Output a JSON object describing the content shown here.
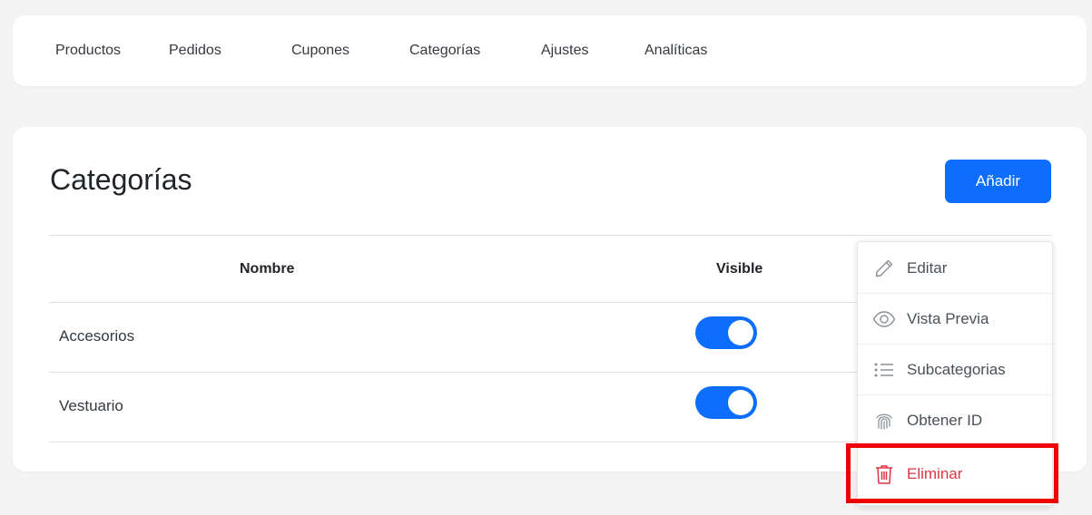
{
  "nav": {
    "items": [
      {
        "label": "Productos"
      },
      {
        "label": "Pedidos"
      },
      {
        "label": "Cupones"
      },
      {
        "label": "Categorías"
      },
      {
        "label": "Ajustes"
      },
      {
        "label": "Analíticas"
      }
    ]
  },
  "page": {
    "title": "Categorías",
    "add_label": "Añadir"
  },
  "table": {
    "headers": {
      "name": "Nombre",
      "visible": "Visible"
    },
    "rows": [
      {
        "name": "Accesorios",
        "visible": true
      },
      {
        "name": "Vestuario",
        "visible": true
      }
    ]
  },
  "context_menu": {
    "items": [
      {
        "label": "Editar",
        "icon": "pencil-icon"
      },
      {
        "label": "Vista Previa",
        "icon": "eye-icon"
      },
      {
        "label": "Subcategorias",
        "icon": "list-icon"
      },
      {
        "label": "Obtener ID",
        "icon": "fingerprint-icon"
      },
      {
        "label": "Eliminar",
        "icon": "trash-icon"
      }
    ]
  },
  "colors": {
    "accent": "#0d6efd",
    "danger": "#dc3545",
    "highlight": "#ee0000"
  }
}
